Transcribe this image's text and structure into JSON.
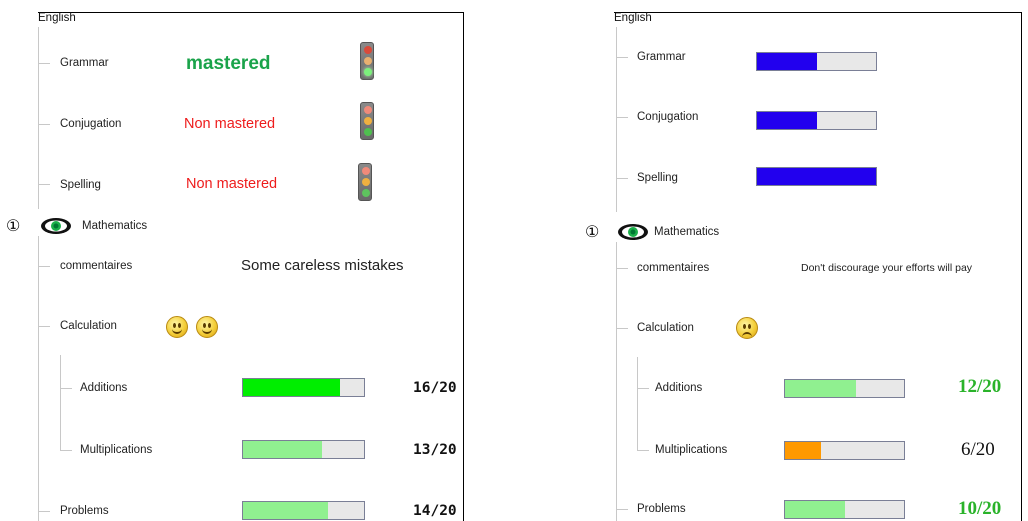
{
  "left": {
    "subject_english": "English",
    "grammar": "Grammar",
    "grammar_status": "mastered",
    "conjugation": "Conjugation",
    "conjugation_status": "Non mastered",
    "spelling": "Spelling",
    "spelling_status": "Non mastered",
    "marker": "①",
    "subject_math": "Mathematics",
    "comments_label": "commentaires",
    "comment": "Some careless mistakes",
    "calculation": "Calculation",
    "additions": "Additions",
    "additions_score": "16/20",
    "additions_fraction": 0.8,
    "multiplications": "Multiplications",
    "multiplications_score": "13/20",
    "multiplications_fraction": 0.65,
    "problems": "Problems",
    "problems_score": "14/20",
    "problems_fraction": 0.7
  },
  "right": {
    "subject_english": "English",
    "grammar": "Grammar",
    "grammar_fraction": 0.5,
    "conjugation": "Conjugation",
    "conjugation_fraction": 0.5,
    "spelling": "Spelling",
    "spelling_fraction": 1.0,
    "marker": "①",
    "subject_math": "Mathematics",
    "comments_label": "commentaires",
    "comment": "Don't discourage your efforts will pay",
    "calculation": "Calculation",
    "additions": "Additions",
    "additions_score": "12/20",
    "additions_fraction": 0.6,
    "multiplications": "Multiplications",
    "multiplications_score": "6/20",
    "multiplications_fraction": 0.3,
    "problems": "Problems",
    "problems_score": "10/20",
    "problems_fraction": 0.5
  },
  "colors": {
    "mastered": "#1aa34a",
    "non_mastered": "#ee1c1c",
    "bar_bright_green": "#00ee00",
    "bar_light_green": "#90f090",
    "bar_blue": "#2200ee",
    "bar_orange": "#ff9900",
    "bar_track": "#e8e8e8"
  },
  "icons": {
    "traffic_light": "traffic-light-icon",
    "eye": "eye-icon",
    "smiley": "smiley-icon",
    "sad_face": "sad-face-icon"
  }
}
